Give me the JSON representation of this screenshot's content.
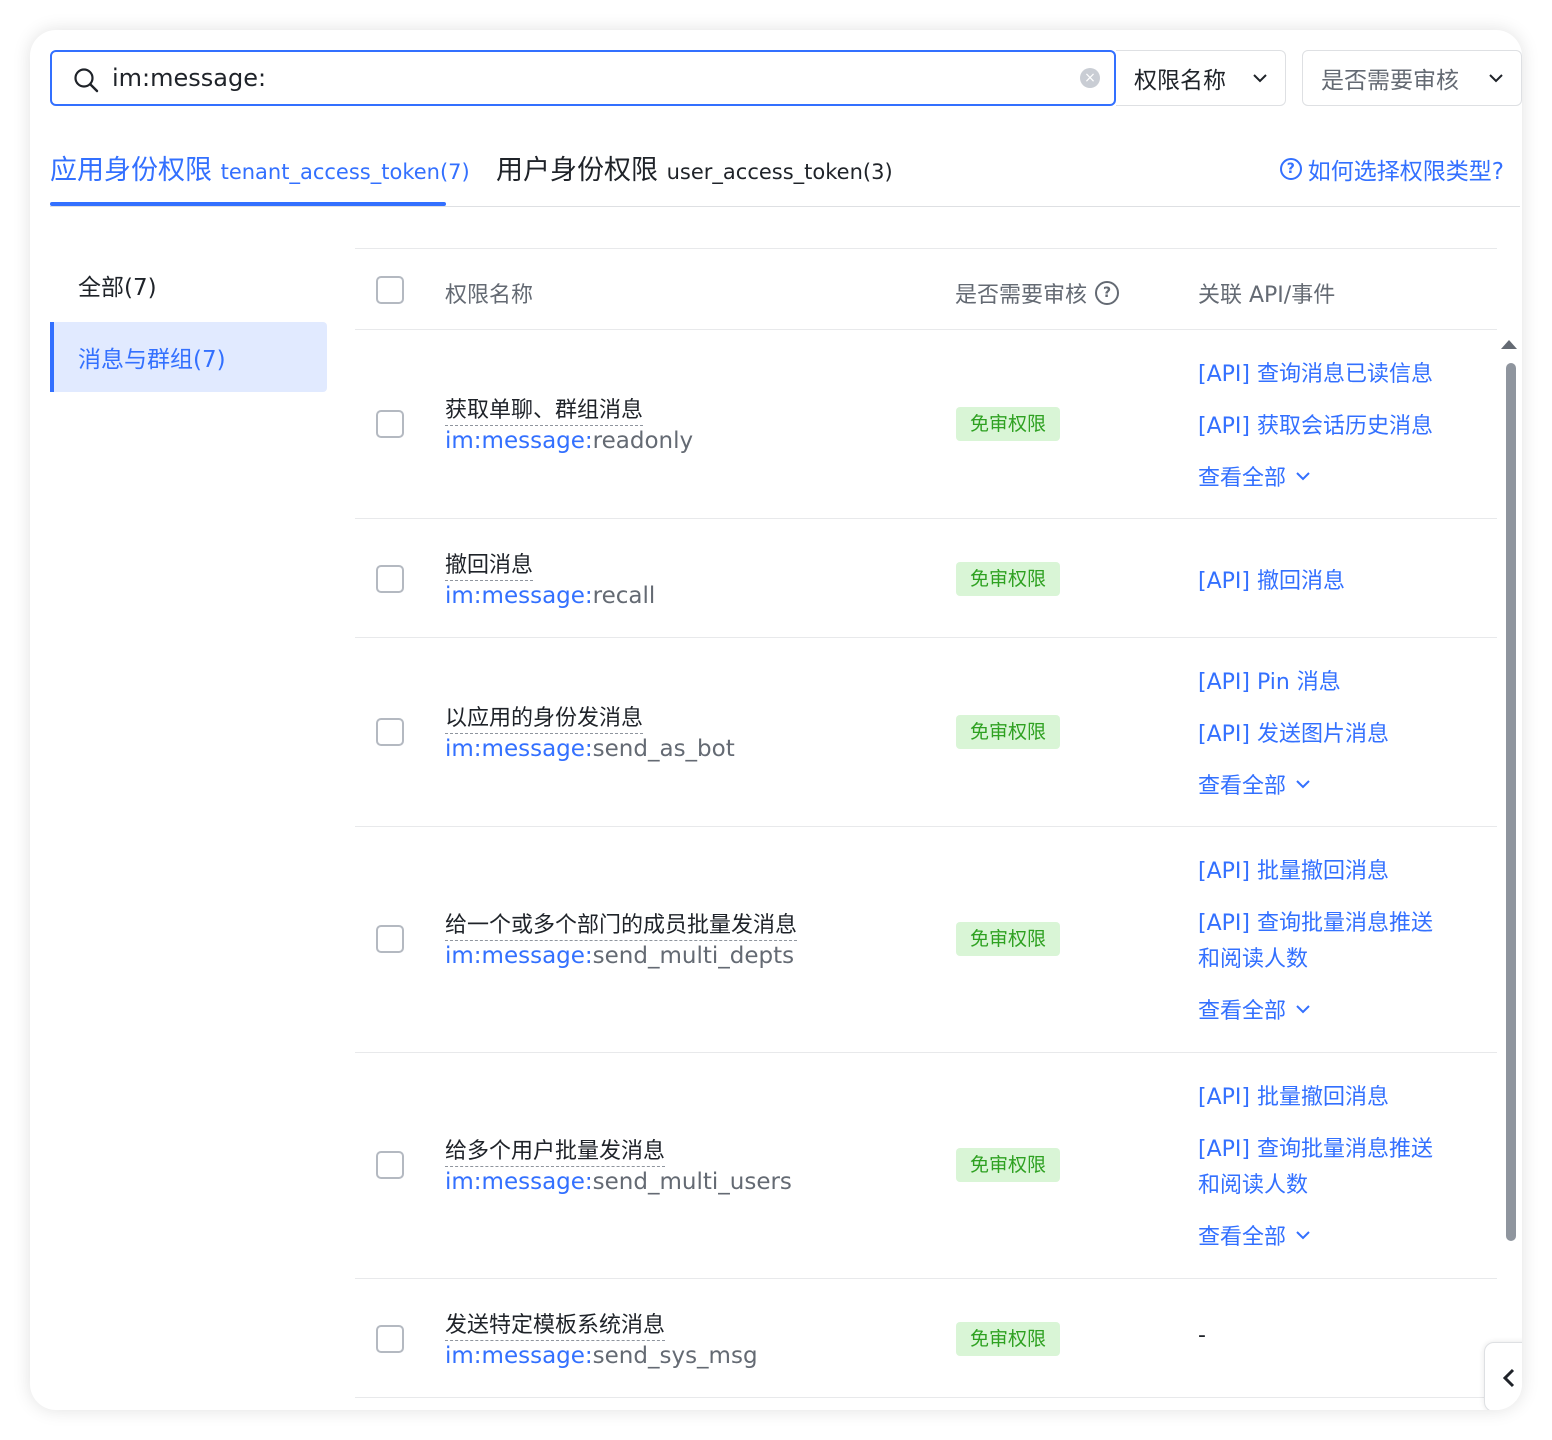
{
  "search": {
    "value": "im:message:"
  },
  "filters": {
    "name_select": "权限名称",
    "review_select": "是否需要审核"
  },
  "tabs": [
    {
      "label": "应用身份权限",
      "token": "tenant_access_token(7)"
    },
    {
      "label": "用户身份权限",
      "token": "user_access_token(3)"
    }
  ],
  "help_link": "如何选择权限类型?",
  "sidebar": {
    "items": [
      {
        "label": "全部(7)"
      },
      {
        "label": "消息与群组(7)"
      }
    ]
  },
  "table": {
    "headers": {
      "name": "权限名称",
      "review": "是否需要审核",
      "api": "关联 API/事件"
    },
    "scope_prefix": "im:message:",
    "badge": "免审权限",
    "view_all": "查看全部",
    "rows": [
      {
        "title": "获取单聊、群组消息",
        "scope_suffix": "readonly",
        "apis": [
          "[API] 查询消息已读信息",
          "[API] 获取会话历史消息"
        ]
      },
      {
        "title": "撤回消息",
        "scope_suffix": "recall",
        "apis": [
          "[API] 撤回消息"
        ]
      },
      {
        "title": "以应用的身份发消息",
        "scope_suffix": "send_as_bot",
        "apis": [
          "[API] Pin 消息",
          "[API] 发送图片消息"
        ]
      },
      {
        "title": "给一个或多个部门的成员批量发消息",
        "scope_suffix": "send_multi_depts",
        "apis": [
          "[API] 批量撤回消息",
          "[API] 查询批量消息推送",
          "和阅读人数"
        ]
      },
      {
        "title": "给多个用户批量发消息",
        "scope_suffix": "send_multi_users",
        "apis": [
          "[API] 批量撤回消息",
          "[API] 查询批量消息推送",
          "和阅读人数"
        ]
      },
      {
        "title": "发送特定模板系统消息",
        "scope_suffix": "send_sys_msg",
        "apis": [
          "-"
        ]
      }
    ]
  }
}
